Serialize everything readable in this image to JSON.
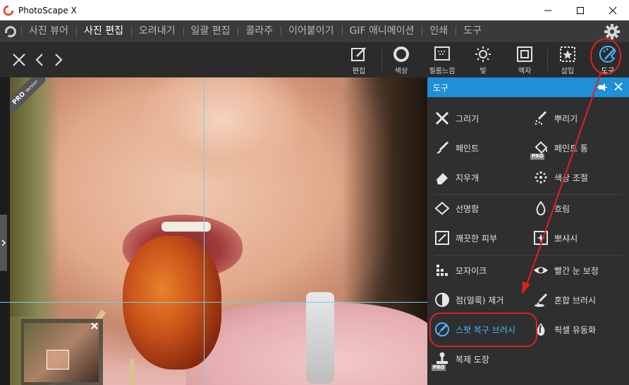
{
  "window": {
    "title": "PhotoScape X"
  },
  "menu": {
    "items": [
      {
        "label": "사진 뷰어"
      },
      {
        "label": "사진 편집"
      },
      {
        "label": "오려내기"
      },
      {
        "label": "일괄 편집"
      },
      {
        "label": "콜라주"
      },
      {
        "label": "이어붙이기"
      },
      {
        "label": "GIF 애니메이션"
      },
      {
        "label": "인쇄"
      },
      {
        "label": "도구"
      }
    ],
    "active_index": 1
  },
  "toolbar": {
    "tools": [
      {
        "label": "편집",
        "icon": "edit-icon"
      },
      {
        "label": "색상",
        "icon": "color-circle-icon"
      },
      {
        "label": "필름느낌",
        "icon": "film-icon"
      },
      {
        "label": "빛",
        "icon": "sun-icon"
      },
      {
        "label": "액자",
        "icon": "frame-icon"
      },
      {
        "label": "삽입",
        "icon": "insert-icon"
      },
      {
        "label": "도구",
        "icon": "tools-palette-icon"
      }
    ]
  },
  "canvas": {
    "badge": "PRO",
    "badge_sub": "Version"
  },
  "panel": {
    "title": "도구",
    "items": [
      {
        "label": "그리기",
        "icon": "draw-icon"
      },
      {
        "label": "뿌리기",
        "icon": "scatter-icon"
      },
      {
        "label": "페인트",
        "icon": "paint-brush-icon"
      },
      {
        "label": "페인트 통",
        "icon": "paint-bucket-icon",
        "pro": "PRO"
      },
      {
        "label": "지우개",
        "icon": "eraser-icon"
      },
      {
        "label": "색상 조절",
        "icon": "color-adjust-icon"
      },
      {
        "label": "선명함",
        "icon": "sharpen-icon"
      },
      {
        "label": "흐림",
        "icon": "blur-drop-icon"
      },
      {
        "label": "깨끗한 피부",
        "icon": "clean-skin-icon"
      },
      {
        "label": "뽀샤시",
        "icon": "glow-icon"
      },
      {
        "label": "모자이크",
        "icon": "mosaic-icon"
      },
      {
        "label": "빨간 눈 보정",
        "icon": "red-eye-icon"
      },
      {
        "label": "점(얼룩) 제거",
        "icon": "spot-remove-icon"
      },
      {
        "label": "혼합 브러시",
        "icon": "blend-brush-icon"
      },
      {
        "label": "스팟 복구 브러시",
        "icon": "spot-heal-brush-icon"
      },
      {
        "label": "픽셀 유동화",
        "icon": "liquify-icon"
      },
      {
        "label": "복제 도장",
        "icon": "clone-stamp-icon",
        "pro": "PRO"
      }
    ]
  },
  "colors": {
    "accent": "#1e8fd8",
    "highlight_text": "#4cb4ff",
    "annotation": "#e02020",
    "guide": "#6fd0e6"
  }
}
